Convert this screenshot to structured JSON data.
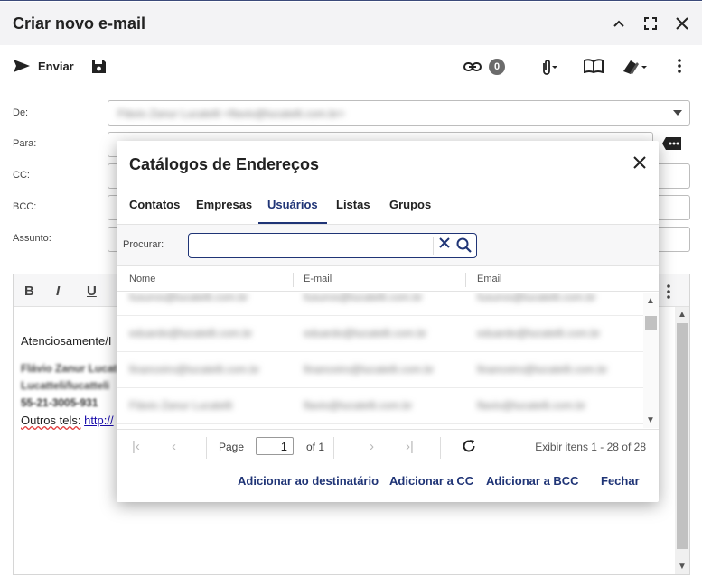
{
  "window": {
    "title": "Criar novo e-mail"
  },
  "toolbar": {
    "send_label": "Enviar",
    "link_count": "0"
  },
  "fields": {
    "from_label": "De:",
    "from_value": "Flávio Zanur Lucatelli <flavio@lucatelli.com.br>",
    "to_label": "Para:",
    "cc_label": "CC:",
    "bcc_label": "BCC:",
    "subject_label": "Assunto:"
  },
  "editor": {
    "line1": "Atenciosamente/I",
    "sig_name": "Flávio Zanur Lucat",
    "sig_link": "Lucatteli/lucatteli",
    "sig_phone": "55-21-3005-931",
    "other_phones_label": "Outros tels:",
    "other_phones_link": "http://"
  },
  "modal": {
    "title": "Catálogos de Endereços",
    "tabs": [
      {
        "label": "Contatos"
      },
      {
        "label": "Empresas"
      },
      {
        "label": "Usuários"
      },
      {
        "label": "Listas"
      },
      {
        "label": "Grupos"
      }
    ],
    "active_tab": "Usuários",
    "search_label": "Procurar:",
    "search_value": "",
    "columns": [
      "Nome",
      "E-mail",
      "Email"
    ],
    "rows": [
      [
        "fusuros@lucatelli.com.br",
        "fusuros@lucatelli.com.br",
        "fusuros@lucatelli.com.br"
      ],
      [
        "eduardo@lucatelli.com.br",
        "eduardo@lucatelli.com.br",
        "eduardo@lucatelli.com.br"
      ],
      [
        "financeiro@lucatelli.com.br",
        "financeiro@lucatelli.com.br",
        "financeiro@lucatelli.com.br"
      ],
      [
        "Flávio Zanur Lucatelli",
        "flavio@lucatelli.com.br",
        "flavio@lucatelli.com.br"
      ]
    ],
    "pager": {
      "page_label": "Page",
      "page_value": "1",
      "of_label": "of 1",
      "info": "Exibir itens 1 - 28 of 28"
    },
    "actions": {
      "add_to": "Adicionar ao destinatário",
      "add_cc": "Adicionar a CC",
      "add_bcc": "Adicionar a BCC",
      "close": "Fechar"
    }
  },
  "colors": {
    "accent": "#1f3476",
    "title_bar": "#f3f3f5"
  }
}
